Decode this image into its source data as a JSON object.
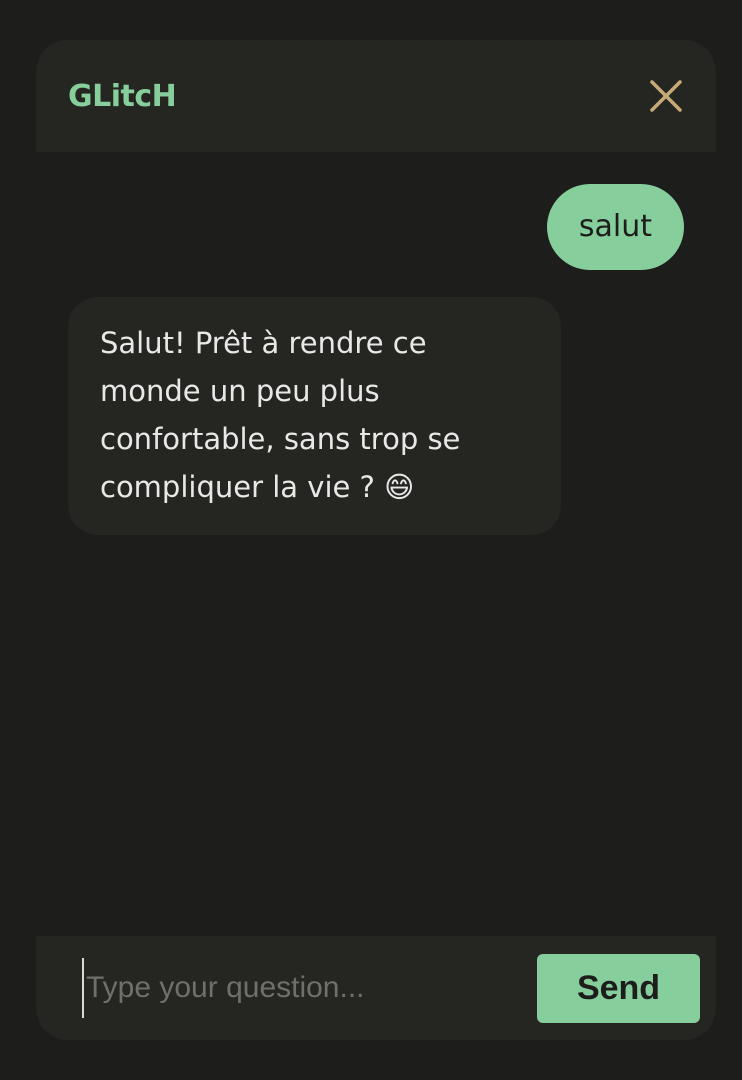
{
  "header": {
    "title": "GLitcH"
  },
  "messages": [
    {
      "from": "user",
      "text": "salut"
    },
    {
      "from": "bot",
      "text": "Salut! Prêt à rendre ce monde un peu plus confortable, sans trop se compliquer la vie ? 😄"
    }
  ],
  "input": {
    "placeholder": "Type your question...",
    "value": ""
  },
  "send_label": "Send",
  "icons": {
    "close": "close-icon"
  },
  "colors": {
    "accent": "#86cf9d",
    "close_icon": "#c7aa77",
    "background": "#1d1e1c",
    "panel": "#252622"
  }
}
